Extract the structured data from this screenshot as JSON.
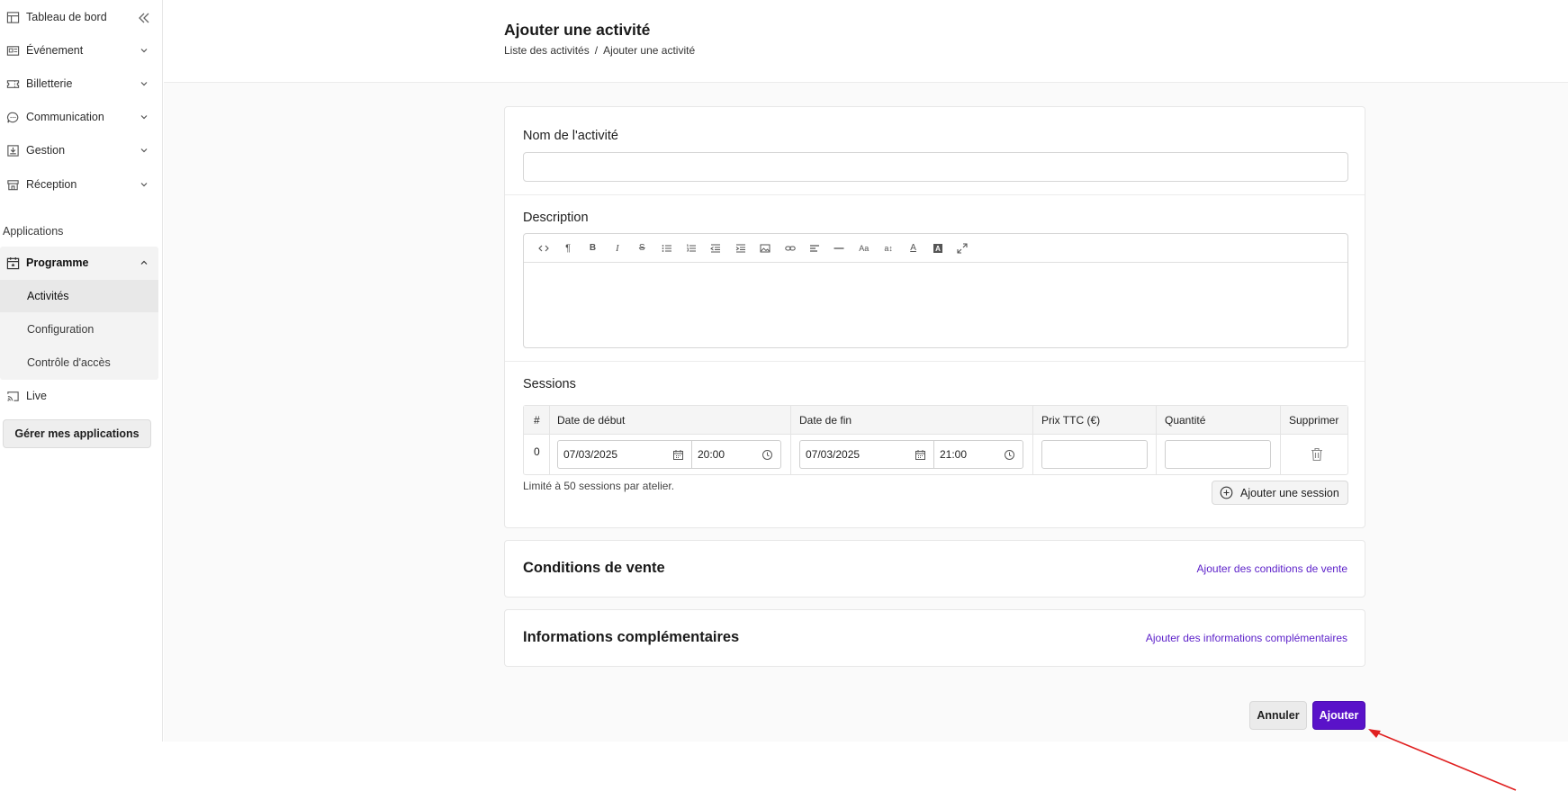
{
  "sidebar": {
    "items": [
      {
        "label": "Tableau de bord",
        "icon": "layout-icon"
      },
      {
        "label": "Événement",
        "icon": "event-card-icon"
      },
      {
        "label": "Billetterie",
        "icon": "ticket-icon"
      },
      {
        "label": "Communication",
        "icon": "chat-icon"
      },
      {
        "label": "Gestion",
        "icon": "download-tray-icon"
      },
      {
        "label": "Réception",
        "icon": "store-icon"
      }
    ],
    "applications_label": "Applications",
    "programme": {
      "label": "Programme",
      "sub_items": [
        "Activités",
        "Configuration",
        "Contrôle d'accès"
      ]
    },
    "live_label": "Live",
    "manage_button": "Gérer mes applications"
  },
  "header": {
    "title": "Ajouter une activité",
    "breadcrumb": [
      "Liste des activités",
      "/",
      "Ajouter une activité"
    ]
  },
  "form": {
    "name_label": "Nom de l'activité",
    "name_value": "",
    "description_label": "Description",
    "sessions_label": "Sessions",
    "sessions_table": {
      "headers": [
        "#",
        "Date de début",
        "Date de fin",
        "Prix TTC (€)",
        "Quantité",
        "Supprimer"
      ],
      "rows": [
        {
          "index": "0",
          "start_date": "07/03/2025",
          "start_time": "20:00",
          "end_date": "07/03/2025",
          "end_time": "21:00",
          "price": "",
          "quantity": ""
        }
      ]
    },
    "limit_note": "Limité à 50 sessions par atelier.",
    "add_session_button": "Ajouter une session"
  },
  "conditions": {
    "title": "Conditions de vente",
    "link": "Ajouter des conditions de vente"
  },
  "info": {
    "title": "Informations complémentaires",
    "link": "Ajouter des informations complémentaires"
  },
  "actions": {
    "cancel": "Annuler",
    "submit": "Ajouter"
  },
  "colors": {
    "accent": "#5a12c9",
    "annotation_arrow": "#e02020"
  }
}
